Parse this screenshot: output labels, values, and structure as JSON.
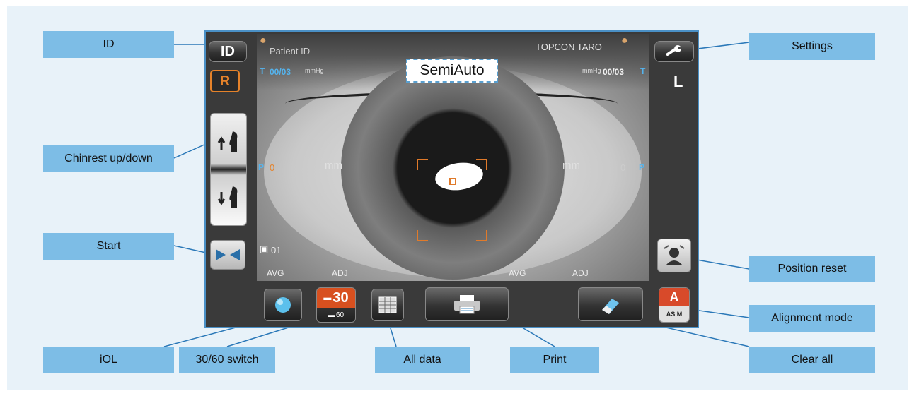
{
  "callouts": {
    "id": "ID",
    "chinrest": "Chinrest up/down",
    "start": "Start",
    "iol": "iOL",
    "switch_3060": "30/60 switch",
    "all_data": "All data",
    "print": "Print",
    "clear_all": "Clear all",
    "alignment_mode": "Alignment mode",
    "position_reset": "Position reset",
    "settings": "Settings"
  },
  "screen": {
    "id_button": "ID",
    "eye_right": "R",
    "eye_left": "L",
    "patient_id": "Patient ID",
    "operator": "TOPCON TARO",
    "count_right": "00/03",
    "count_left": "00/03",
    "unit_mmhg": "mmHg",
    "unit_mm": "mm",
    "mode": "SemiAuto",
    "small_value_left": "0",
    "small_value_right": "0",
    "page": "01",
    "avg": "AVG",
    "adj": "ADJ",
    "switch_top": "30",
    "switch_bottom": "60",
    "align_top": "A",
    "align_bottom": "AS M"
  }
}
